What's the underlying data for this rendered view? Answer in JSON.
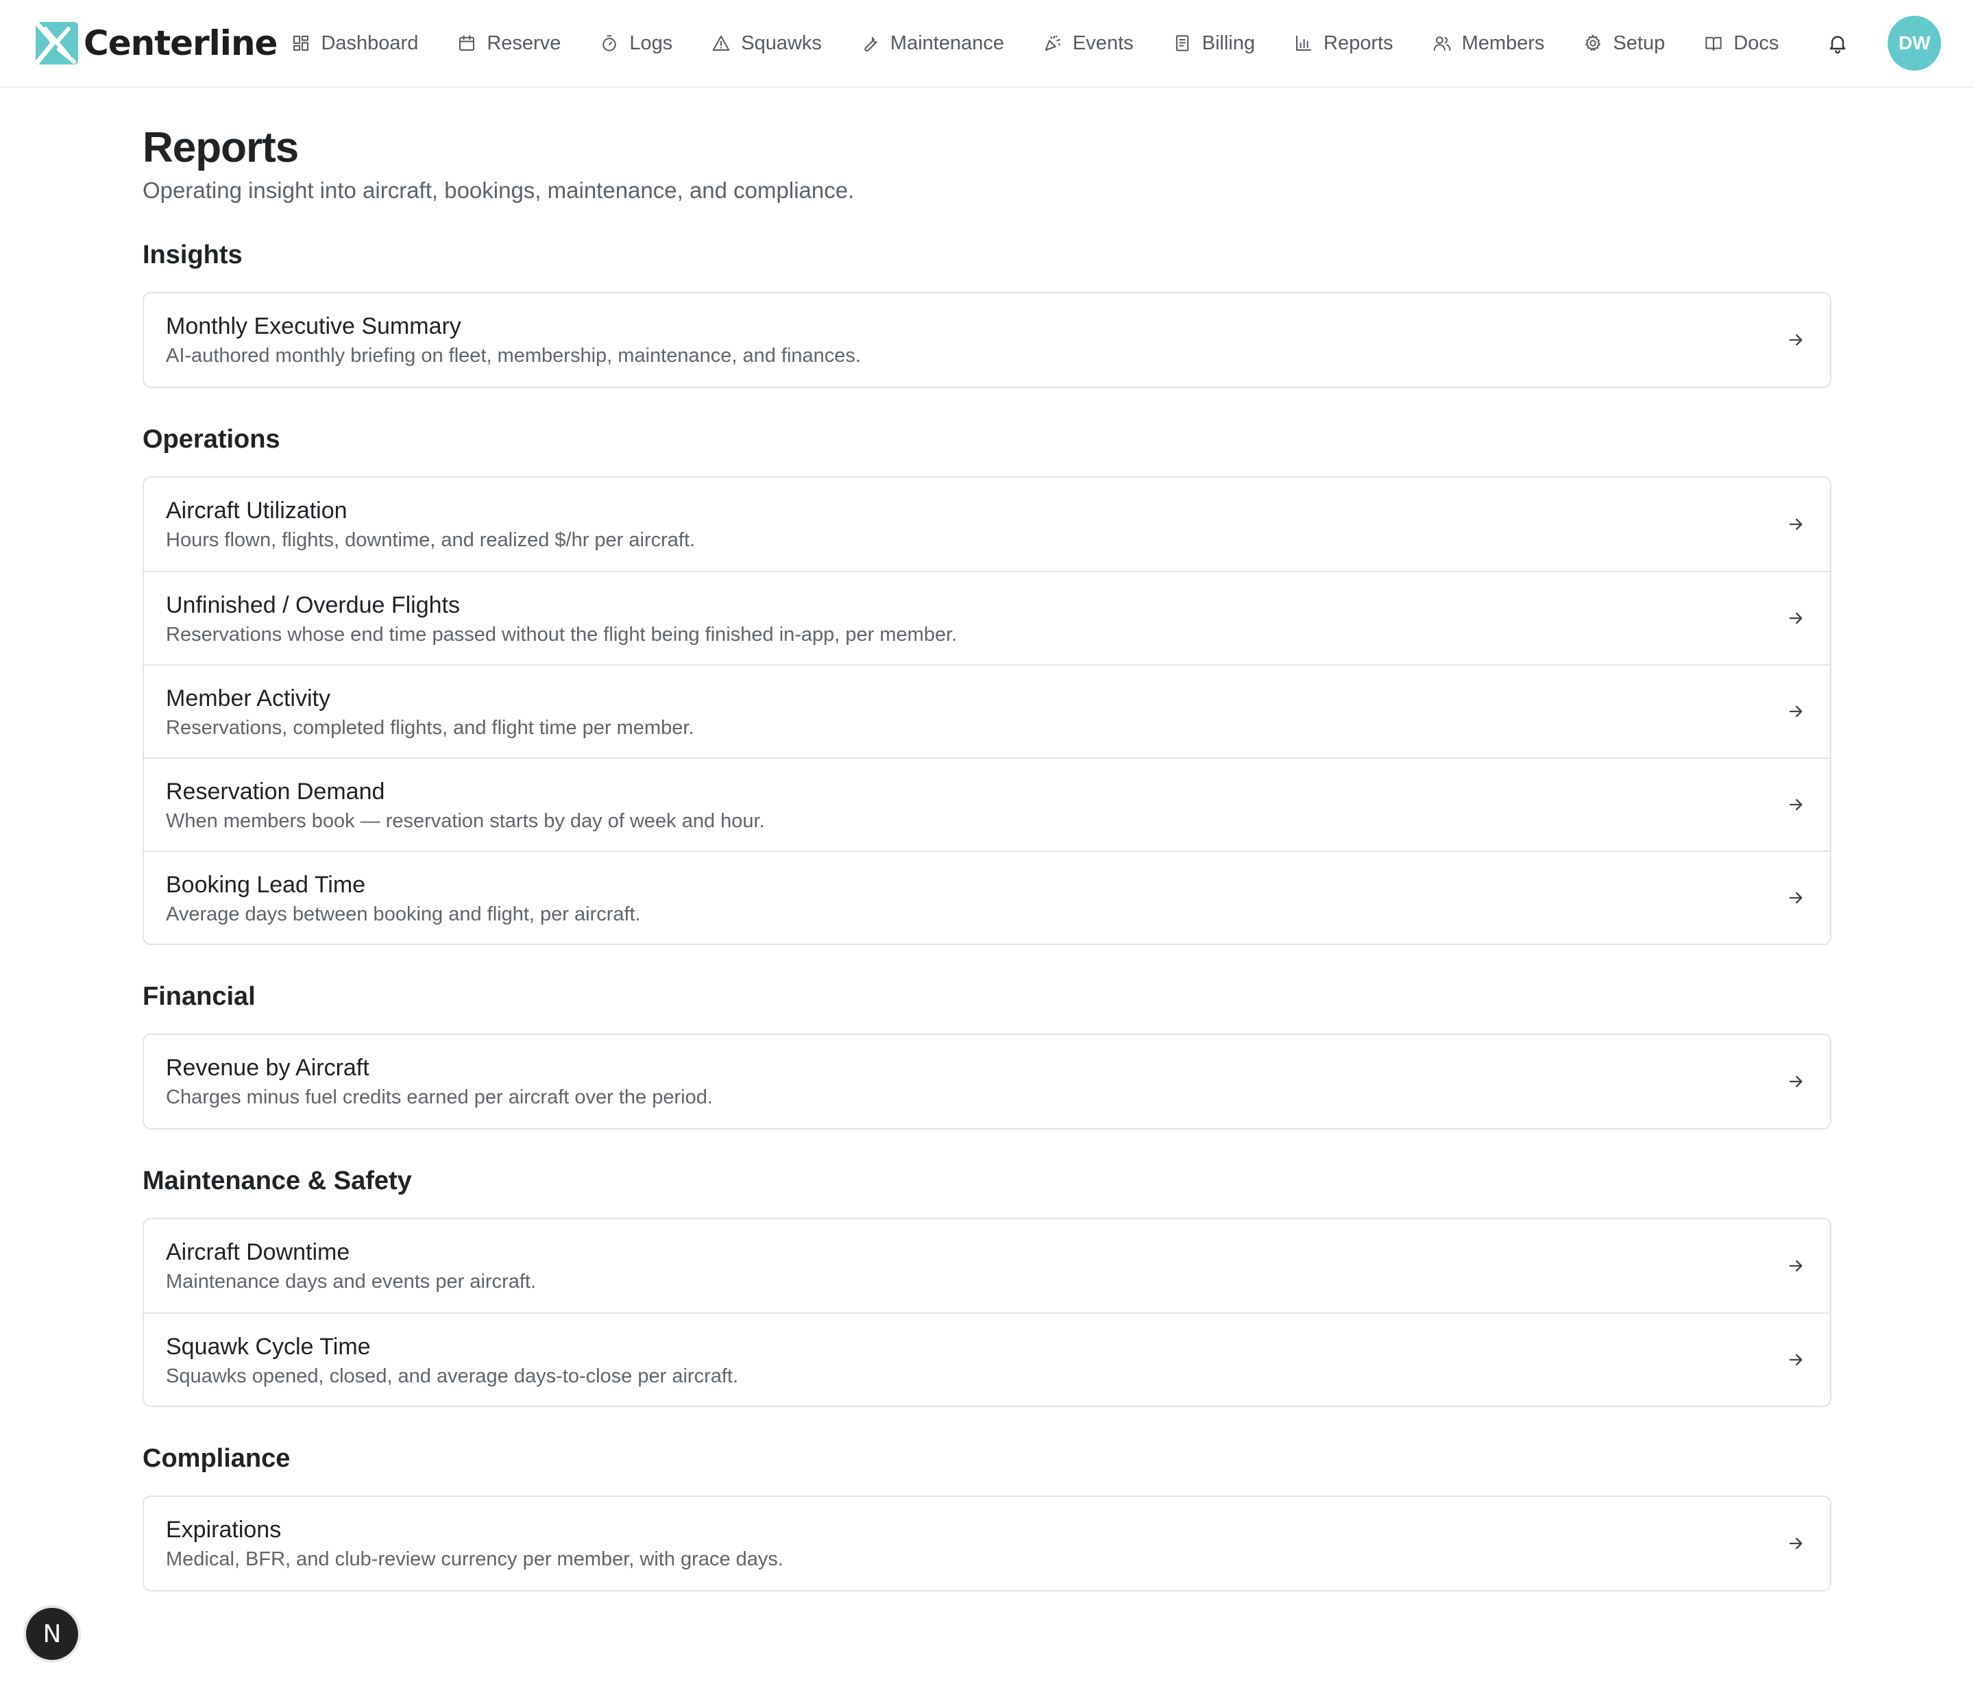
{
  "app": {
    "name": "Centerline",
    "accent": "#63c9cd"
  },
  "nav": [
    {
      "label": "Dashboard",
      "icon": "dashboard-icon"
    },
    {
      "label": "Reserve",
      "icon": "calendar-icon"
    },
    {
      "label": "Logs",
      "icon": "stopwatch-icon"
    },
    {
      "label": "Squawks",
      "icon": "warning-icon"
    },
    {
      "label": "Maintenance",
      "icon": "wrench-icon"
    },
    {
      "label": "Events",
      "icon": "party-popper-icon"
    },
    {
      "label": "Billing",
      "icon": "receipt-icon"
    },
    {
      "label": "Reports",
      "icon": "bar-chart-icon"
    },
    {
      "label": "Members",
      "icon": "users-icon"
    },
    {
      "label": "Setup",
      "icon": "gear-icon"
    },
    {
      "label": "Docs",
      "icon": "book-icon"
    }
  ],
  "user": {
    "initials": "DW"
  },
  "page": {
    "title": "Reports",
    "subtitle": "Operating insight into aircraft, bookings, maintenance, and compliance."
  },
  "sections": [
    {
      "title": "Insights",
      "items": [
        {
          "title": "Monthly Executive Summary",
          "desc": "AI-authored monthly briefing on fleet, membership, maintenance, and finances."
        }
      ]
    },
    {
      "title": "Operations",
      "items": [
        {
          "title": "Aircraft Utilization",
          "desc": "Hours flown, flights, downtime, and realized $/hr per aircraft."
        },
        {
          "title": "Unfinished / Overdue Flights",
          "desc": "Reservations whose end time passed without the flight being finished in-app, per member."
        },
        {
          "title": "Member Activity",
          "desc": "Reservations, completed flights, and flight time per member."
        },
        {
          "title": "Reservation Demand",
          "desc": "When members book — reservation starts by day of week and hour."
        },
        {
          "title": "Booking Lead Time",
          "desc": "Average days between booking and flight, per aircraft."
        }
      ]
    },
    {
      "title": "Financial",
      "items": [
        {
          "title": "Revenue by Aircraft",
          "desc": "Charges minus fuel credits earned per aircraft over the period."
        }
      ]
    },
    {
      "title": "Maintenance & Safety",
      "items": [
        {
          "title": "Aircraft Downtime",
          "desc": "Maintenance days and events per aircraft."
        },
        {
          "title": "Squawk Cycle Time",
          "desc": "Squawks opened, closed, and average days-to-close per aircraft."
        }
      ]
    },
    {
      "title": "Compliance",
      "items": [
        {
          "title": "Expirations",
          "desc": "Medical, BFR, and club-review currency per member, with grace days."
        }
      ]
    }
  ],
  "fab": {
    "label": "N"
  }
}
